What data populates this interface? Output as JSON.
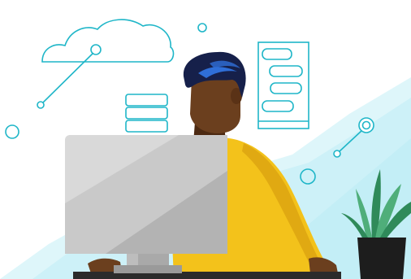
{
  "scene": {
    "subject": "person-at-desktop-computer",
    "colors": {
      "line_accent": "#1fb6c8",
      "backdrop_light": "#def6fa",
      "backdrop_mid": "#b9ecf4",
      "skin": "#6b3f1e",
      "skin_shadow": "#4d2a12",
      "hair": "#16204a",
      "hair_highlight": "#2f6fd8",
      "sweater": "#f3c21b",
      "sweater_shadow": "#e0a912",
      "monitor_light": "#d9d9d9",
      "monitor_dark": "#b3b3b3",
      "plant": "#4fae7a",
      "plant_dark": "#2f8a5a",
      "pot": "#1d1d1d",
      "desk": "#2b2b2b"
    },
    "icons": [
      "cloud-icon",
      "server-stack-icon",
      "app-screen-icon",
      "node-connector-icon"
    ]
  }
}
